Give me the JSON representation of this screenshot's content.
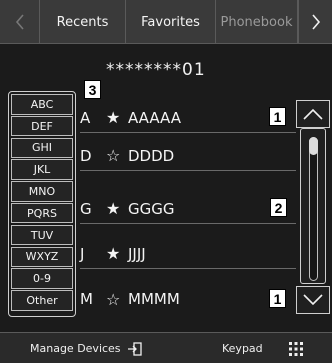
{
  "tabs": {
    "prev_icon": "chevron-left-icon",
    "items": [
      {
        "label": "Recents"
      },
      {
        "label": "Favorites"
      },
      {
        "label": "Phonebook"
      }
    ],
    "next_icon": "chevron-right-icon",
    "active": "Phonebook"
  },
  "dialed_number": "********01",
  "index": [
    "ABC",
    "DEF",
    "GHI",
    "JKL",
    "MNO",
    "PQRS",
    "TUV",
    "WXYZ",
    "0-9",
    "Other"
  ],
  "callouts": [
    "3",
    "1",
    "2",
    "1"
  ],
  "contacts": [
    {
      "letter": "A",
      "star": "★",
      "name": "AAAAA",
      "favorite": true
    },
    {
      "letter": "D",
      "star": "☆",
      "name": "DDDD",
      "favorite": false
    },
    {
      "letter": "G",
      "star": "★",
      "name": "GGGG",
      "favorite": true
    },
    {
      "letter": "J",
      "star": "★",
      "name": "JJJJ",
      "favorite": true
    },
    {
      "letter": "M",
      "star": "☆",
      "name": "MMMM",
      "favorite": false
    }
  ],
  "scroll": {
    "up_icon": "chevron-up-icon",
    "down_icon": "chevron-down-icon",
    "position": 0.0
  },
  "bottom": {
    "manage_label": "Manage Devices",
    "manage_icon": "device-link-icon",
    "keypad_label": "Keypad",
    "keypad_icon": "keypad-grid-icon"
  }
}
